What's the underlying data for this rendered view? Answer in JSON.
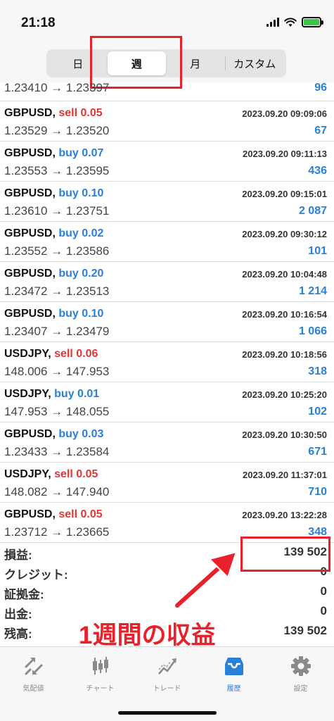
{
  "status": {
    "time": "21:18"
  },
  "period_tabs": [
    {
      "label": "日",
      "active": false
    },
    {
      "label": "週",
      "active": true
    },
    {
      "label": "月",
      "active": false
    },
    {
      "label": "カスタム",
      "active": false
    }
  ],
  "colors": {
    "buy": "#2a7fd9",
    "sell": "#e23636",
    "annotation": "#e8222a",
    "active_tab": "#2a7fd9"
  },
  "partial_row": {
    "prices": "1.23410 → 1.23397",
    "profit": "96"
  },
  "trades": [
    {
      "symbol": "GBPUSD,",
      "side": "sell 0.05",
      "type": "sell",
      "time": "2023.09.20 09:09:06",
      "prices": "1.23529 → 1.23520",
      "profit": "67"
    },
    {
      "symbol": "GBPUSD,",
      "side": "buy 0.07",
      "type": "buy",
      "time": "2023.09.20 09:11:13",
      "prices": "1.23553 → 1.23595",
      "profit": "436"
    },
    {
      "symbol": "GBPUSD,",
      "side": "buy 0.10",
      "type": "buy",
      "time": "2023.09.20 09:15:01",
      "prices": "1.23610 → 1.23751",
      "profit": "2 087"
    },
    {
      "symbol": "GBPUSD,",
      "side": "buy 0.02",
      "type": "buy",
      "time": "2023.09.20 09:30:12",
      "prices": "1.23552 → 1.23586",
      "profit": "101"
    },
    {
      "symbol": "GBPUSD,",
      "side": "buy 0.20",
      "type": "buy",
      "time": "2023.09.20 10:04:48",
      "prices": "1.23472 → 1.23513",
      "profit": "1 214"
    },
    {
      "symbol": "GBPUSD,",
      "side": "buy 0.10",
      "type": "buy",
      "time": "2023.09.20 10:16:54",
      "prices": "1.23407 → 1.23479",
      "profit": "1 066"
    },
    {
      "symbol": "USDJPY,",
      "side": "sell 0.06",
      "type": "sell",
      "time": "2023.09.20 10:18:56",
      "prices": "148.006 → 147.953",
      "profit": "318"
    },
    {
      "symbol": "USDJPY,",
      "side": "buy 0.01",
      "type": "buy",
      "time": "2023.09.20 10:25:20",
      "prices": "147.953 → 148.055",
      "profit": "102"
    },
    {
      "symbol": "GBPUSD,",
      "side": "buy 0.03",
      "type": "buy",
      "time": "2023.09.20 10:30:50",
      "prices": "1.23433 → 1.23584",
      "profit": "671"
    },
    {
      "symbol": "USDJPY,",
      "side": "sell 0.05",
      "type": "sell",
      "time": "2023.09.20 11:37:01",
      "prices": "148.082 → 147.940",
      "profit": "710"
    },
    {
      "symbol": "GBPUSD,",
      "side": "sell 0.05",
      "type": "sell",
      "time": "2023.09.20 13:22:28",
      "prices": "1.23712 → 1.23665",
      "profit": "348"
    }
  ],
  "summary": {
    "profit_label": "損益:",
    "profit_value": "139 502",
    "credit_label": "クレジット:",
    "credit_value": "0",
    "deposit_label": "証拠金:",
    "deposit_value": "0",
    "withdrawal_label": "出金:",
    "withdrawal_value": "0",
    "balance_label": "残高:",
    "balance_value": "139 502"
  },
  "annotation": "1週間の収益",
  "tab_bar": [
    {
      "label": "気配値",
      "icon": "quotes-icon",
      "active": false
    },
    {
      "label": "チャート",
      "icon": "chart-icon",
      "active": false
    },
    {
      "label": "トレード",
      "icon": "trade-icon",
      "active": false
    },
    {
      "label": "履歴",
      "icon": "history-icon",
      "active": true
    },
    {
      "label": "設定",
      "icon": "gear-icon",
      "active": false
    }
  ]
}
